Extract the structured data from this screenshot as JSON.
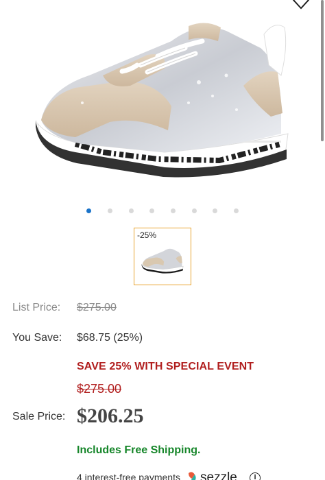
{
  "gallery": {
    "dot_count": 8,
    "active_index": 0,
    "thumbnail_badge": "-25%"
  },
  "pricing": {
    "list_price_label": "List Price:",
    "list_price_value": "$275.00",
    "you_save_label": "You Save:",
    "you_save_value": "$68.75 (25%)",
    "event_text": "SAVE 25% WITH SPECIAL EVENT",
    "event_original_price": "$275.00",
    "sale_price_label": "Sale Price:",
    "sale_price_value": "$206.25",
    "shipping_text": "Includes Free Shipping.",
    "installment_text": "4 interest-free payments",
    "sezzle_brand": "sezzle",
    "info_glyph": "i"
  },
  "colors": {
    "accent_blue": "#1a73c9",
    "event_red": "#b11e1e",
    "shipping_green": "#16862a",
    "thumb_border": "#e8a22c"
  },
  "icons": [
    "heart-icon",
    "info-icon",
    "sezzle-logo"
  ]
}
